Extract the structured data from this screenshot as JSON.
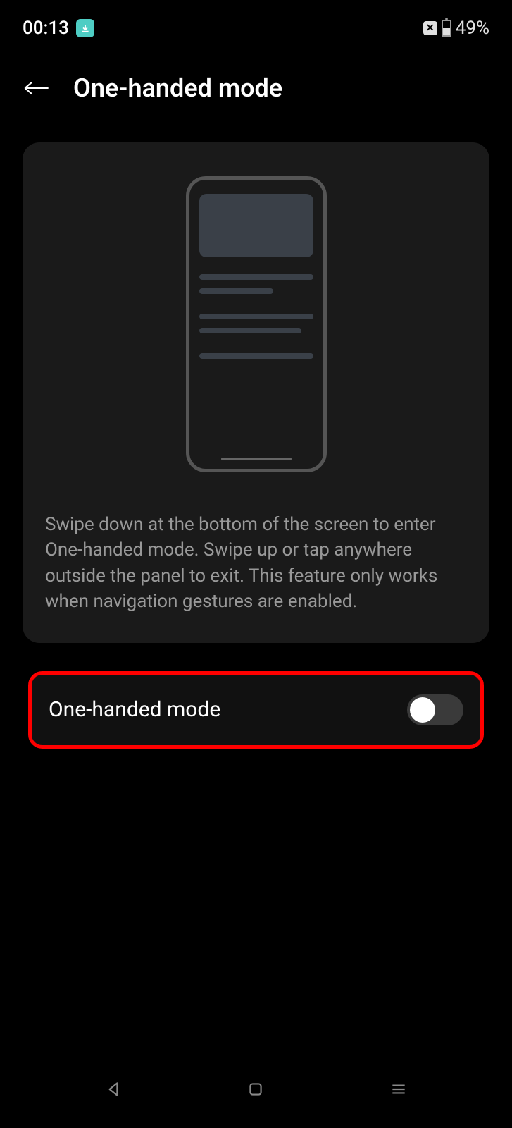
{
  "status_bar": {
    "time": "00:13",
    "battery_percent": "49%"
  },
  "header": {
    "title": "One-handed mode"
  },
  "info": {
    "description": "Swipe down at the bottom of the screen to enter One-handed mode. Swipe up or tap anywhere outside the panel to exit. This feature only works when navigation gestures are enabled."
  },
  "toggle": {
    "label": "One-handed mode",
    "enabled": false
  }
}
